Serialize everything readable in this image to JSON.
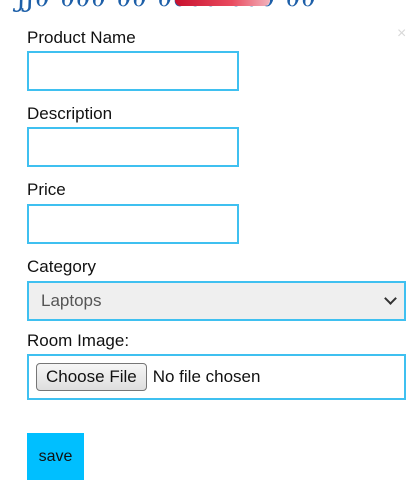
{
  "modal": {
    "close_glyph": "×"
  },
  "form": {
    "product_name": {
      "label": "Product Name",
      "value": "",
      "placeholder": ""
    },
    "description": {
      "label": "Description",
      "value": "",
      "placeholder": ""
    },
    "price": {
      "label": "Price",
      "value": "",
      "placeholder": ""
    },
    "category": {
      "label": "Category",
      "selected": "Laptops"
    },
    "room_image": {
      "label": "Room Image:",
      "button_label": "Choose File",
      "status": "No file chosen"
    },
    "save_label": "save"
  },
  "colors": {
    "input_border": "#3fc0f0",
    "save_button": "#00bfff",
    "select_background": "#efefef"
  },
  "icons": {
    "close": "close-icon",
    "dropdown": "chevron-down-icon"
  }
}
